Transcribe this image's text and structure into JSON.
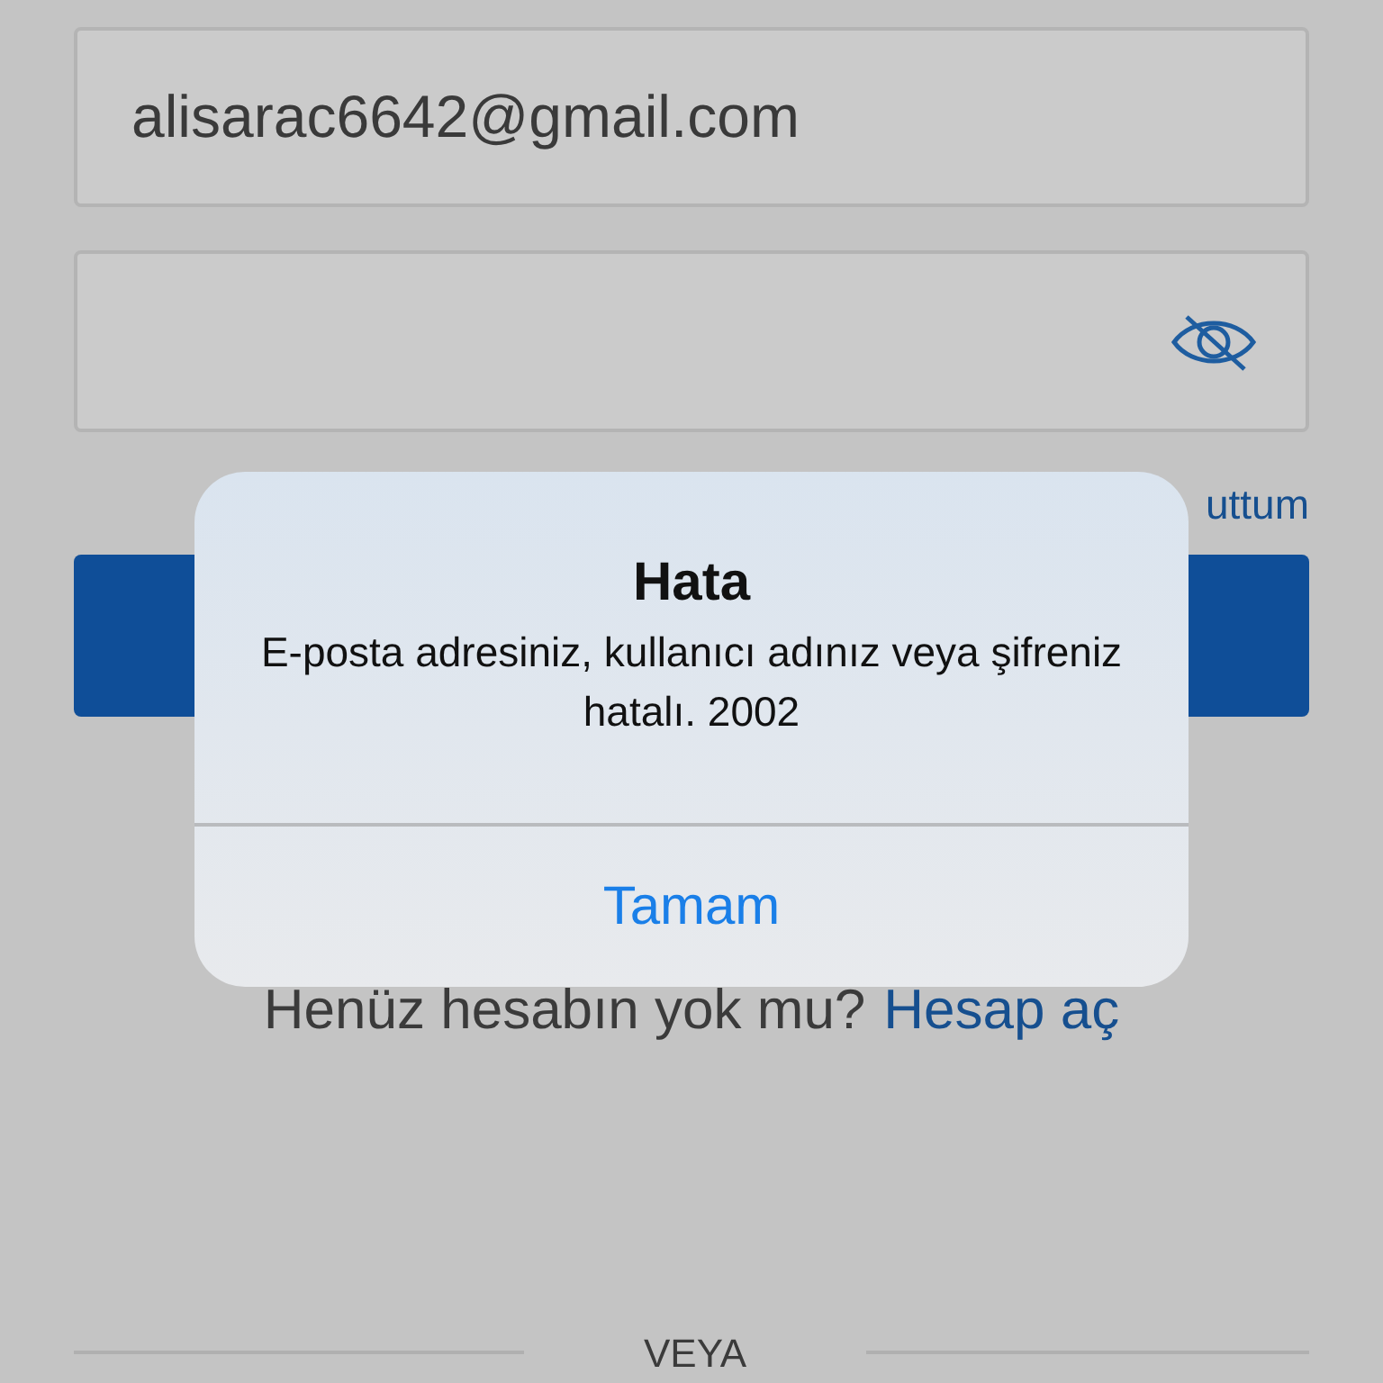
{
  "email_field": {
    "value": "alisarac6642@gmail.com"
  },
  "password_field": {
    "password_visible": false
  },
  "forgot_password_link": "uttum",
  "signup_prompt": {
    "text": "Henüz hesabın yok mu?",
    "link": "Hesap aç"
  },
  "divider_label": "VEYA",
  "alert": {
    "title": "Hata",
    "message": "E-posta adresiniz, kullanıcı adınız veya şifreniz hatalı. 2002",
    "buttons": [
      "Tamam"
    ]
  }
}
